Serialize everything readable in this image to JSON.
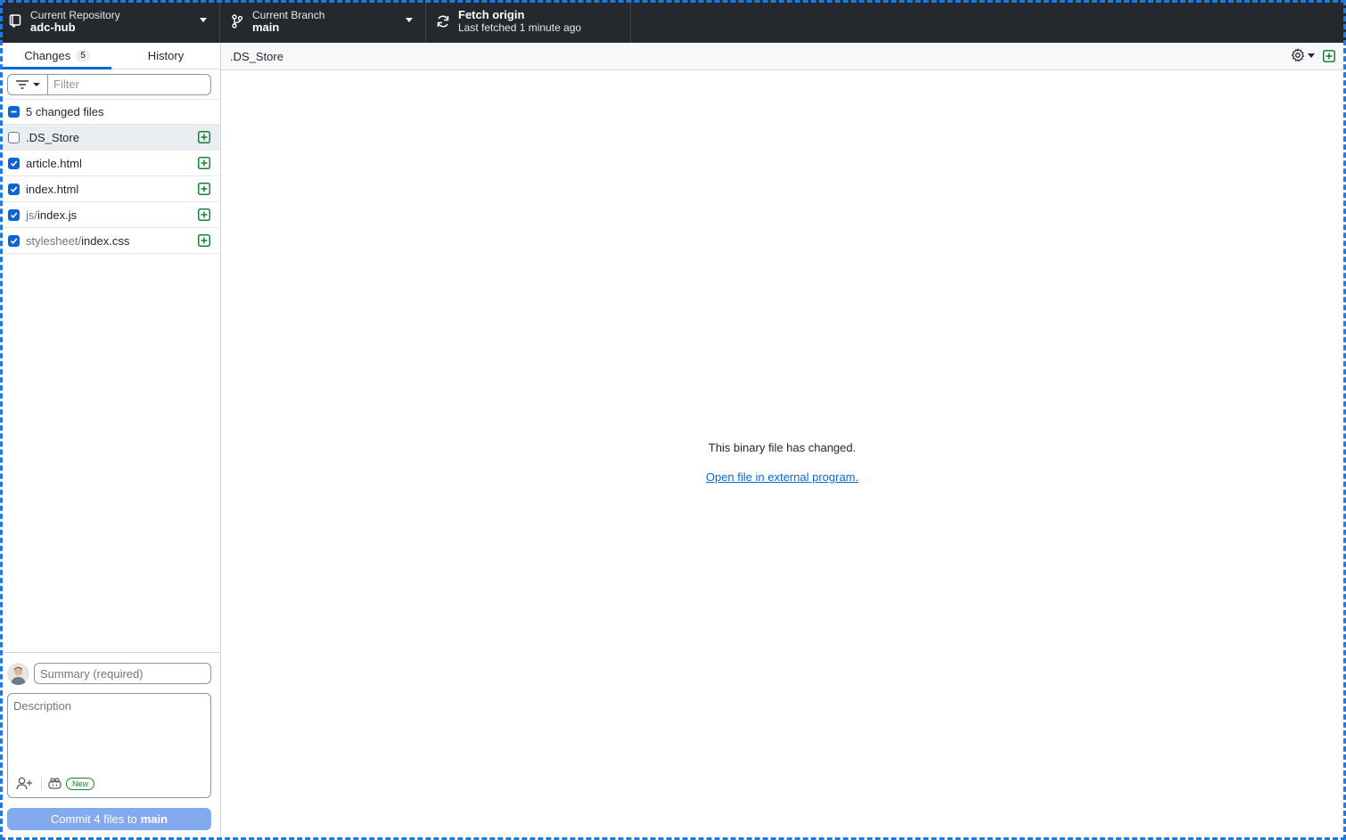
{
  "toolbar": {
    "repo": {
      "small": "Current Repository",
      "big": "adc-hub"
    },
    "branch": {
      "small": "Current Branch",
      "big": "main"
    },
    "fetch": {
      "big": "Fetch origin",
      "small": "Last fetched 1 minute ago"
    }
  },
  "sidebar": {
    "tabs": [
      {
        "label": "Changes",
        "count": "5"
      },
      {
        "label": "History"
      }
    ],
    "filter_placeholder": "Filter",
    "changed_files_label": "5 changed files",
    "files": [
      {
        "dir": "",
        "name": ".DS_Store",
        "checked": false
      },
      {
        "dir": "",
        "name": "article.html",
        "checked": true
      },
      {
        "dir": "",
        "name": "index.html",
        "checked": true
      },
      {
        "dir": "js/",
        "name": "index.js",
        "checked": true
      },
      {
        "dir": "stylesheet/",
        "name": "index.css",
        "checked": true
      }
    ]
  },
  "commit": {
    "summary_placeholder": "Summary (required)",
    "description_placeholder": "Description",
    "new_badge": "New",
    "button_prefix": "Commit 4 files to",
    "button_branch": "main"
  },
  "main": {
    "header_file": ".DS_Store",
    "binary_message": "This binary file has changed.",
    "open_link": "Open file in external program."
  },
  "colors": {
    "toolbar_bg": "#24292e",
    "accent": "#0969da",
    "add_green": "#1a7f37",
    "commit_button": "#84aaee",
    "focus_frame": "#1f7ae0"
  }
}
